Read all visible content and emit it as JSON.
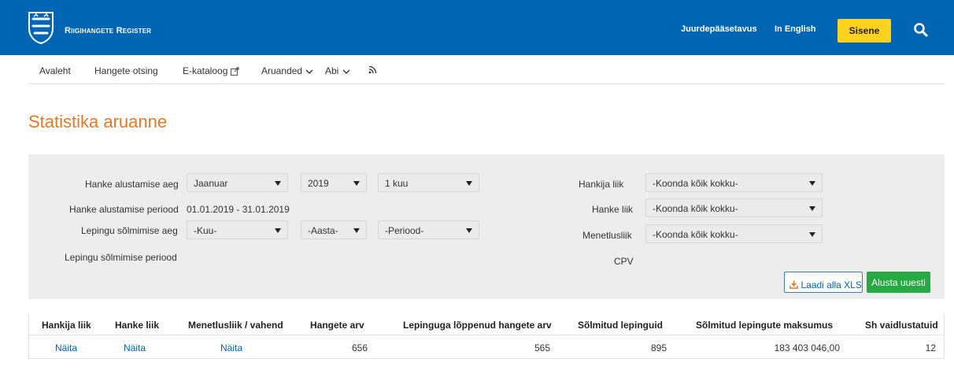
{
  "header": {
    "brand": "Riigihangete Register",
    "accessibility": "Juurdepääsetavus",
    "english": "In English",
    "login": "Sisene",
    "colors": {
      "bar": "#0066b3",
      "login_button": "#ffd21e"
    }
  },
  "nav": {
    "items": [
      "Avaleht",
      "Hangete otsing",
      "E-kataloog",
      "Aruanded",
      "Abi"
    ],
    "icons": [
      "external-link-icon",
      "chevron-down-icon",
      "chevron-down-icon",
      "rss-icon"
    ]
  },
  "page": {
    "title": "Statistika aruanne",
    "title_color": "#e87722"
  },
  "filters": {
    "start_time_label": "Hanke alustamise aeg",
    "start_month": "Jaanuar",
    "start_year": "2019",
    "start_length": "1 kuu",
    "start_period_label": "Hanke alustamise periood",
    "start_period_value": "01.01.2019 - 31.01.2019",
    "contract_time_label": "Lepingu sõlmimise aeg",
    "contract_month": "-Kuu-",
    "contract_year": "-Aasta-",
    "contract_length": "-Periood-",
    "contract_period_label": "Lepingu sõlmimise periood",
    "buyer_type_label": "Hankija liik",
    "buyer_type_value": "-Koonda kõik kokku-",
    "procurement_type_label": "Hanke liik",
    "procurement_type_value": "-Koonda kõik kokku-",
    "procedure_label": "Menetlusliik",
    "procedure_value": "-Koonda kõik kokku-",
    "cpv_label": "CPV"
  },
  "actions": {
    "download_xls": "Laadi alla XLS",
    "reset": "Alusta uuesti",
    "reset_color": "#26a843"
  },
  "table": {
    "headers": [
      "Hankija liik",
      "Hanke liik",
      "Menetlusliik / vahend",
      "Hangete arv",
      "Lepinguga lõppenud hangete arv",
      "Sõlmitud lepinguid",
      "Sõlmitud lepingute maksumus",
      "Sh vaidlustatuid"
    ],
    "row": [
      "Näita",
      "Näita",
      "Näita",
      "656",
      "565",
      "895",
      "183 403 046,00",
      "12"
    ]
  }
}
